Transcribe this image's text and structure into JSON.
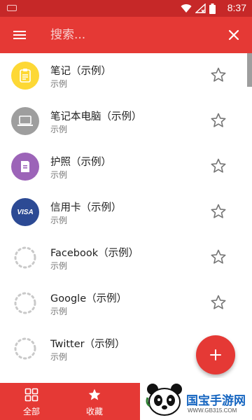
{
  "status_bar": {
    "time": "8:37"
  },
  "app_bar": {
    "search_placeholder": "搜索...",
    "menu_icon": "hamburger-menu-icon",
    "close_icon": "close-icon"
  },
  "items": [
    {
      "title": "笔记（示例）",
      "subtitle": "示例",
      "icon": "note-icon",
      "color": "#fdd835"
    },
    {
      "title": "笔记本电脑（示例）",
      "subtitle": "示例",
      "icon": "laptop-icon",
      "color": "#9e9e9e"
    },
    {
      "title": "护照（示例）",
      "subtitle": "示例",
      "icon": "passport-icon",
      "color": "#9c64b8"
    },
    {
      "title": "信用卡（示例）",
      "subtitle": "示例",
      "icon": "visa-card-icon",
      "color": "#2c4a94",
      "badge": "VISA"
    },
    {
      "title": "Facebook（示例）",
      "subtitle": "示例",
      "icon": "loading-spinner-icon"
    },
    {
      "title": "Google（示例）",
      "subtitle": "示例",
      "icon": "loading-spinner-icon"
    },
    {
      "title": "Twitter（示例）",
      "subtitle": "示例",
      "icon": "loading-spinner-icon"
    }
  ],
  "bottom_nav": [
    {
      "label": "全部",
      "icon": "grid-icon"
    },
    {
      "label": "收藏",
      "icon": "star-icon"
    }
  ],
  "fab": {
    "icon": "plus-icon"
  },
  "watermark": {
    "text": "国宝手游网",
    "url": "WWW.GB315.COM"
  },
  "colors": {
    "primary": "#e53935",
    "primary_dark": "#c62828",
    "accent": "#e53935"
  }
}
